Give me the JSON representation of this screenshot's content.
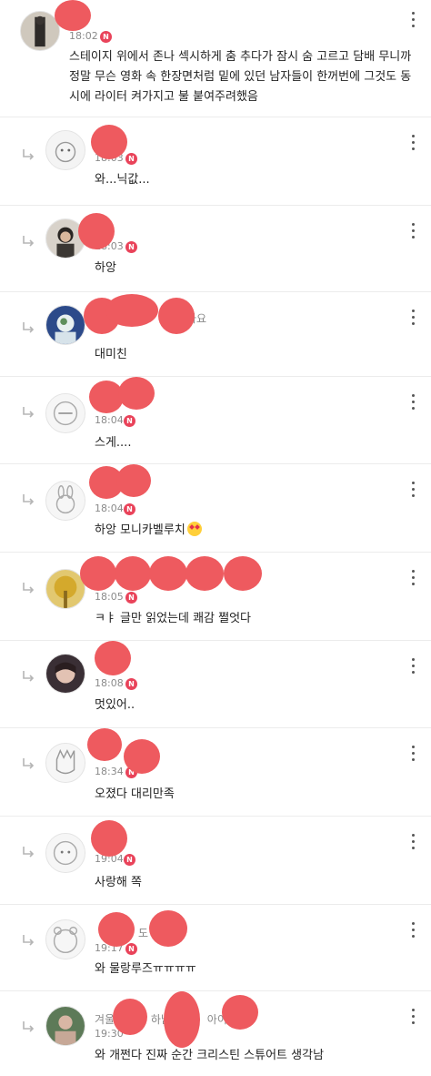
{
  "colors": {
    "badge": "#e9435a",
    "redaction": "#ee5a5f",
    "divider": "#ececec"
  },
  "badge_label": "N",
  "menu_icon": "more-vertical-icon",
  "reply_icon": "reply-arrow-icon",
  "comments": [
    {
      "time": "18:02",
      "nick_partial": "",
      "text": "스테이지 위에서 존나 섹시하게 춤 추다가 잠시 숨 고르고 담배 무니까 정말 무슨 영화 속 한장면처럼 밑에 있던 남자들이 한꺼번에 그것도 동시에 라이터 켜가지고 불 붙여주려했음"
    },
    {
      "time": "18:03",
      "nick_partial": "",
      "text": "와...닉값..."
    },
    {
      "time": "18:03",
      "nick_partial": "",
      "text": "하앙"
    },
    {
      "time": "",
      "nick_partial": "나요",
      "text": "대미친"
    },
    {
      "time": "18:04",
      "nick_partial": "",
      "text": "스게...."
    },
    {
      "time": "18:04",
      "nick_partial": "",
      "text": "하앙 모니카벨루치"
    },
    {
      "time": "18:05",
      "nick_partial": "",
      "text": "ㅋㅑ 글만 읽었는데 쾌감 쩔엇다"
    },
    {
      "time": "18:08",
      "nick_partial": "",
      "text": "멋있어.."
    },
    {
      "time": "18:34",
      "nick_partial": "",
      "text": "오졌다 대리만족"
    },
    {
      "time": "19:04",
      "nick_partial": "",
      "text": "사랑해 쪽"
    },
    {
      "time": "19:17",
      "nick_partial": "도",
      "text": "와 물랑루즈ㅠㅠㅠㅠ"
    },
    {
      "time": "19:30",
      "nick_partial": "겨울 하남 아이",
      "text": "와 개쩐다 진짜 순간 크리스틴 스튜어트 생각남"
    }
  ]
}
